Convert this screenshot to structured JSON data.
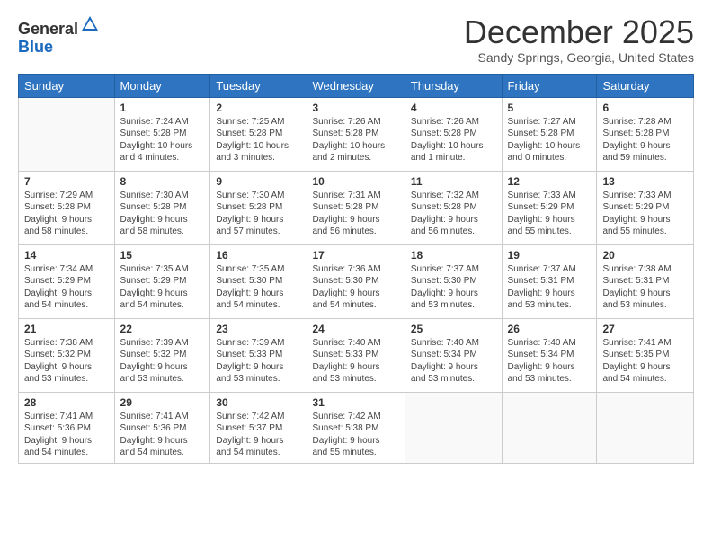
{
  "header": {
    "logo_general": "General",
    "logo_blue": "Blue",
    "month_title": "December 2025",
    "subtitle": "Sandy Springs, Georgia, United States"
  },
  "weekdays": [
    "Sunday",
    "Monday",
    "Tuesday",
    "Wednesday",
    "Thursday",
    "Friday",
    "Saturday"
  ],
  "weeks": [
    [
      {
        "day": "",
        "info": ""
      },
      {
        "day": "1",
        "info": "Sunrise: 7:24 AM\nSunset: 5:28 PM\nDaylight: 10 hours\nand 4 minutes."
      },
      {
        "day": "2",
        "info": "Sunrise: 7:25 AM\nSunset: 5:28 PM\nDaylight: 10 hours\nand 3 minutes."
      },
      {
        "day": "3",
        "info": "Sunrise: 7:26 AM\nSunset: 5:28 PM\nDaylight: 10 hours\nand 2 minutes."
      },
      {
        "day": "4",
        "info": "Sunrise: 7:26 AM\nSunset: 5:28 PM\nDaylight: 10 hours\nand 1 minute."
      },
      {
        "day": "5",
        "info": "Sunrise: 7:27 AM\nSunset: 5:28 PM\nDaylight: 10 hours\nand 0 minutes."
      },
      {
        "day": "6",
        "info": "Sunrise: 7:28 AM\nSunset: 5:28 PM\nDaylight: 9 hours\nand 59 minutes."
      }
    ],
    [
      {
        "day": "7",
        "info": "Sunrise: 7:29 AM\nSunset: 5:28 PM\nDaylight: 9 hours\nand 58 minutes."
      },
      {
        "day": "8",
        "info": "Sunrise: 7:30 AM\nSunset: 5:28 PM\nDaylight: 9 hours\nand 58 minutes."
      },
      {
        "day": "9",
        "info": "Sunrise: 7:30 AM\nSunset: 5:28 PM\nDaylight: 9 hours\nand 57 minutes."
      },
      {
        "day": "10",
        "info": "Sunrise: 7:31 AM\nSunset: 5:28 PM\nDaylight: 9 hours\nand 56 minutes."
      },
      {
        "day": "11",
        "info": "Sunrise: 7:32 AM\nSunset: 5:28 PM\nDaylight: 9 hours\nand 56 minutes."
      },
      {
        "day": "12",
        "info": "Sunrise: 7:33 AM\nSunset: 5:29 PM\nDaylight: 9 hours\nand 55 minutes."
      },
      {
        "day": "13",
        "info": "Sunrise: 7:33 AM\nSunset: 5:29 PM\nDaylight: 9 hours\nand 55 minutes."
      }
    ],
    [
      {
        "day": "14",
        "info": "Sunrise: 7:34 AM\nSunset: 5:29 PM\nDaylight: 9 hours\nand 54 minutes."
      },
      {
        "day": "15",
        "info": "Sunrise: 7:35 AM\nSunset: 5:29 PM\nDaylight: 9 hours\nand 54 minutes."
      },
      {
        "day": "16",
        "info": "Sunrise: 7:35 AM\nSunset: 5:30 PM\nDaylight: 9 hours\nand 54 minutes."
      },
      {
        "day": "17",
        "info": "Sunrise: 7:36 AM\nSunset: 5:30 PM\nDaylight: 9 hours\nand 54 minutes."
      },
      {
        "day": "18",
        "info": "Sunrise: 7:37 AM\nSunset: 5:30 PM\nDaylight: 9 hours\nand 53 minutes."
      },
      {
        "day": "19",
        "info": "Sunrise: 7:37 AM\nSunset: 5:31 PM\nDaylight: 9 hours\nand 53 minutes."
      },
      {
        "day": "20",
        "info": "Sunrise: 7:38 AM\nSunset: 5:31 PM\nDaylight: 9 hours\nand 53 minutes."
      }
    ],
    [
      {
        "day": "21",
        "info": "Sunrise: 7:38 AM\nSunset: 5:32 PM\nDaylight: 9 hours\nand 53 minutes."
      },
      {
        "day": "22",
        "info": "Sunrise: 7:39 AM\nSunset: 5:32 PM\nDaylight: 9 hours\nand 53 minutes."
      },
      {
        "day": "23",
        "info": "Sunrise: 7:39 AM\nSunset: 5:33 PM\nDaylight: 9 hours\nand 53 minutes."
      },
      {
        "day": "24",
        "info": "Sunrise: 7:40 AM\nSunset: 5:33 PM\nDaylight: 9 hours\nand 53 minutes."
      },
      {
        "day": "25",
        "info": "Sunrise: 7:40 AM\nSunset: 5:34 PM\nDaylight: 9 hours\nand 53 minutes."
      },
      {
        "day": "26",
        "info": "Sunrise: 7:40 AM\nSunset: 5:34 PM\nDaylight: 9 hours\nand 53 minutes."
      },
      {
        "day": "27",
        "info": "Sunrise: 7:41 AM\nSunset: 5:35 PM\nDaylight: 9 hours\nand 54 minutes."
      }
    ],
    [
      {
        "day": "28",
        "info": "Sunrise: 7:41 AM\nSunset: 5:36 PM\nDaylight: 9 hours\nand 54 minutes."
      },
      {
        "day": "29",
        "info": "Sunrise: 7:41 AM\nSunset: 5:36 PM\nDaylight: 9 hours\nand 54 minutes."
      },
      {
        "day": "30",
        "info": "Sunrise: 7:42 AM\nSunset: 5:37 PM\nDaylight: 9 hours\nand 54 minutes."
      },
      {
        "day": "31",
        "info": "Sunrise: 7:42 AM\nSunset: 5:38 PM\nDaylight: 9 hours\nand 55 minutes."
      },
      {
        "day": "",
        "info": ""
      },
      {
        "day": "",
        "info": ""
      },
      {
        "day": "",
        "info": ""
      }
    ]
  ]
}
